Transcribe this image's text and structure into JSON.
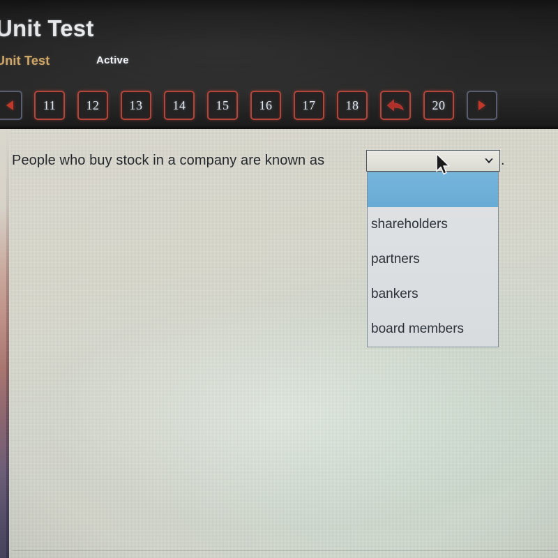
{
  "header": {
    "title": "Unit Test",
    "subtitle": "Unit Test",
    "status": "Active"
  },
  "pager": {
    "prev_icon": "triangle-left-icon",
    "next_icon": "triangle-right-icon",
    "flagged_icon": "red-arrow-left-icon",
    "items": [
      {
        "kind": "prev",
        "label": ""
      },
      {
        "kind": "number",
        "label": "11"
      },
      {
        "kind": "number",
        "label": "12"
      },
      {
        "kind": "number",
        "label": "13"
      },
      {
        "kind": "number",
        "label": "14"
      },
      {
        "kind": "number",
        "label": "15"
      },
      {
        "kind": "number",
        "label": "16"
      },
      {
        "kind": "number",
        "label": "17"
      },
      {
        "kind": "number",
        "label": "18"
      },
      {
        "kind": "flag",
        "label": ""
      },
      {
        "kind": "number",
        "label": "20"
      },
      {
        "kind": "next",
        "label": ""
      }
    ]
  },
  "question": {
    "text": "People who buy stock in a company are known as",
    "trailing_punctuation": ".",
    "select": {
      "value": "",
      "chevron_icon": "chevron-down-icon",
      "options": [
        {
          "label": "",
          "selected": true
        },
        {
          "label": "shareholders",
          "selected": false
        },
        {
          "label": "partners",
          "selected": false
        },
        {
          "label": "bankers",
          "selected": false
        },
        {
          "label": "board members",
          "selected": false
        }
      ]
    }
  },
  "cursor": {
    "icon": "mouse-pointer-icon"
  },
  "colors": {
    "header_bg": "#2a2a2a",
    "accent_red": "#b3453a",
    "subtitle_gold": "#cfa86a",
    "select_highlight_blue": "#6fb0d8",
    "page_bg": "#dcdbd0"
  }
}
